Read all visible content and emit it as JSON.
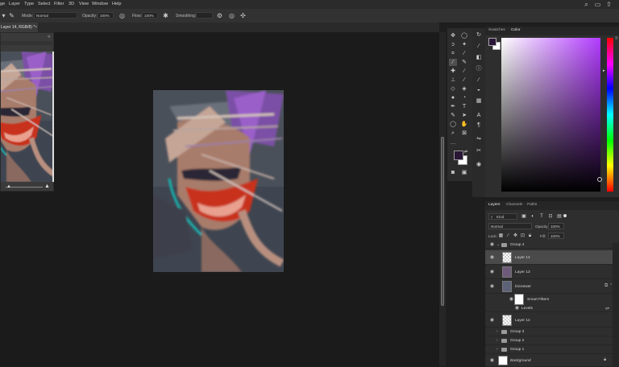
{
  "menubar": {
    "items": [
      "ge",
      "Layer",
      "Type",
      "Select",
      "Filter",
      "3D",
      "View",
      "Window",
      "Help"
    ]
  },
  "options": {
    "mode_label": "Mode:",
    "mode_value": "Normal",
    "opacity_label": "Opacity:",
    "opacity_value": "100%",
    "flow_label": "Flow:",
    "flow_value": "100%",
    "smoothing_label": "Smoothing:",
    "smoothing_value": ""
  },
  "document": {
    "tab_title": "Layer 14, RGB/8) *",
    "close": "×"
  },
  "color_panel": {
    "tabs": [
      "Swatches",
      "Color"
    ],
    "foreground": "#2a1636",
    "background": "#ffffff",
    "hue_color": "#b23cff"
  },
  "layers_panel": {
    "tabs": [
      "Layers",
      "Channels",
      "Paths"
    ],
    "filter_kind": "Kind",
    "blend_mode": "Normal",
    "opacity_label": "Opacity:",
    "opacity_value": "100%",
    "lock_label": "Lock:",
    "fill_label": "Fill:",
    "fill_value": "100%",
    "layers": [
      {
        "name": "Group 4",
        "type": "group",
        "visible": true,
        "expanded": true
      },
      {
        "name": "Layer 14",
        "type": "layer",
        "visible": true,
        "selected": true
      },
      {
        "name": "Layer 13",
        "type": "layer",
        "visible": true
      },
      {
        "name": "lcicnewer",
        "type": "smart",
        "visible": true
      },
      {
        "name": "Smart Filters",
        "type": "smart-filters",
        "visible": true
      },
      {
        "name": "Levels",
        "type": "filter",
        "visible": true
      },
      {
        "name": "Layer 12",
        "type": "layer",
        "visible": true
      },
      {
        "name": "Group 3",
        "type": "group",
        "visible": false
      },
      {
        "name": "Group 2",
        "type": "group",
        "visible": false
      },
      {
        "name": "Group 1",
        "type": "group",
        "visible": false
      },
      {
        "name": "Background",
        "type": "background",
        "visible": true,
        "italic": true
      }
    ]
  }
}
